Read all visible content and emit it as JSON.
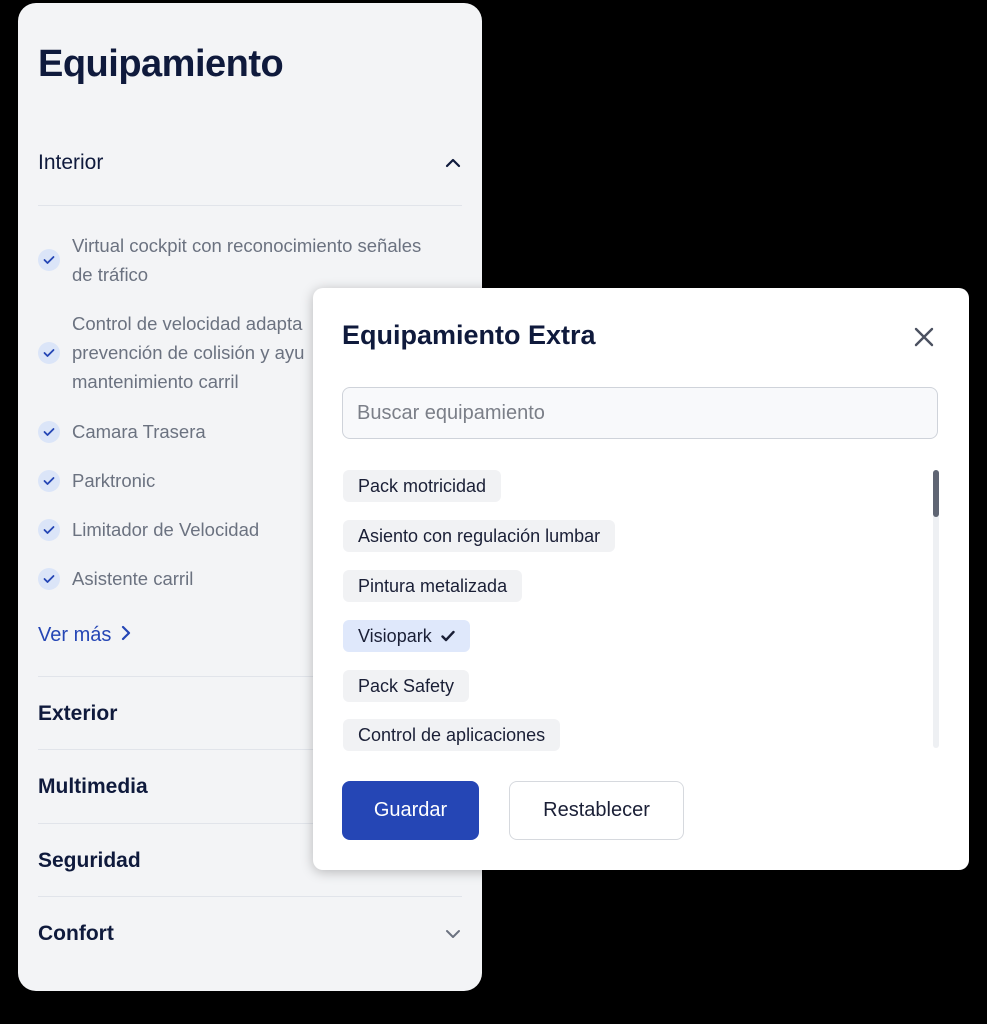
{
  "panel": {
    "title": "Equipamiento",
    "interior": {
      "label": "Interior",
      "expanded": true,
      "icon": "chevron-up-icon",
      "features": [
        {
          "line1": "Virtual cockpit con reconocimiento señales",
          "line2": "de tráfico",
          "line3": ""
        },
        {
          "line1": "Control de velocidad adapta",
          "line2": "prevención de colisión y ayu",
          "line3": "mantenimiento carril"
        },
        {
          "line1": "Camara Trasera",
          "line2": "",
          "line3": ""
        },
        {
          "line1": "Parktronic",
          "line2": "",
          "line3": ""
        },
        {
          "line1": "Limitador de Velocidad",
          "line2": "",
          "line3": ""
        },
        {
          "line1": "Asistente carril",
          "line2": "",
          "line3": ""
        }
      ],
      "see_more": "Ver más"
    },
    "sections": [
      {
        "label": "Exterior"
      },
      {
        "label": "Multimedia"
      },
      {
        "label": "Seguridad"
      },
      {
        "label": "Confort",
        "icon": "chevron-down-icon"
      }
    ]
  },
  "modal": {
    "title": "Equipamiento Extra",
    "search_placeholder": "Buscar equipamiento",
    "search_value": "",
    "options": [
      {
        "label": "Pack motricidad",
        "selected": false
      },
      {
        "label": "Asiento con regulación lumbar",
        "selected": false
      },
      {
        "label": "Pintura metalizada",
        "selected": false
      },
      {
        "label": "Visiopark",
        "selected": true
      },
      {
        "label": "Pack Safety",
        "selected": false
      },
      {
        "label": "Control de aplicaciones",
        "selected": false
      }
    ],
    "save_label": "Guardar",
    "reset_label": "Restablecer"
  },
  "colors": {
    "accent": "#2546b5",
    "heading": "#0f1a3c",
    "panel_bg": "#f3f4f6",
    "check_bg": "#dbe5f8",
    "selected_chip": "#dfe8fb"
  }
}
